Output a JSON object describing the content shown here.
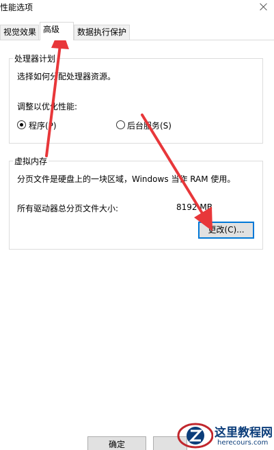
{
  "window": {
    "title": "性能选项"
  },
  "tabs": [
    {
      "label": "视觉效果",
      "active": false
    },
    {
      "label": "高级",
      "active": true
    },
    {
      "label": "数据执行保护",
      "active": false
    }
  ],
  "processor": {
    "group_title": "处理器计划",
    "description": "选择如何分配处理器资源。",
    "adjust_label": "调整以优化性能:",
    "options": [
      {
        "label": "程序(P)",
        "selected": true
      },
      {
        "label": "后台服务(S)",
        "selected": false
      }
    ]
  },
  "virtual_memory": {
    "group_title": "虚拟内存",
    "description": "分页文件是硬盘上的一块区域，Windows 当作 RAM 使用。",
    "total_label": "所有驱动器总分页文件大小:",
    "total_value": "8192 MB",
    "change_button": "更改(C)..."
  },
  "footer": {
    "ok_button": "确定",
    "cancel_button": ""
  },
  "watermark": {
    "title": "这里教程网",
    "url": "herecours.com"
  },
  "colors": {
    "arrow": "#e8373a",
    "focus_border": "#0078d7",
    "logo": "#0b3d7a"
  }
}
